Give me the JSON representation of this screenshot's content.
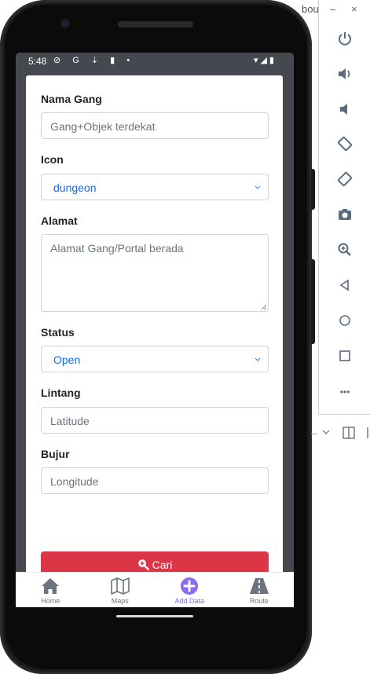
{
  "status_bar": {
    "time": "5:48",
    "left_icons": "⊘ G ⇣ ▮ •",
    "right_icons": "▾◢▮"
  },
  "form": {
    "nama_gang": {
      "label": "Nama Gang",
      "placeholder": "Gang+Objek terdekat",
      "value": ""
    },
    "icon": {
      "label": "Icon",
      "selected": "dungeon"
    },
    "alamat": {
      "label": "Alamat",
      "placeholder": "Alamat Gang/Portal berada",
      "value": ""
    },
    "status": {
      "label": "Status",
      "selected": "Open"
    },
    "lintang": {
      "label": "Lintang",
      "placeholder": "Latitude",
      "value": ""
    },
    "bujur": {
      "label": "Bujur",
      "placeholder": "Longitude",
      "value": ""
    },
    "submit_label": "Cari"
  },
  "tabs": [
    {
      "label": "Home",
      "icon": "home-icon",
      "active": false
    },
    {
      "label": "Maps",
      "icon": "map-icon",
      "active": false
    },
    {
      "label": "Add Data",
      "icon": "plus-circle-icon",
      "active": true
    },
    {
      "label": "Route",
      "icon": "road-icon",
      "active": false
    }
  ],
  "emulator": {
    "title_fragment": "bou",
    "minimize": "–",
    "close": "×",
    "more": "•••"
  },
  "colors": {
    "accent": "#8a6cf2",
    "danger": "#dc3545",
    "link": "#0d6efd",
    "statusbar": "#45484e"
  }
}
